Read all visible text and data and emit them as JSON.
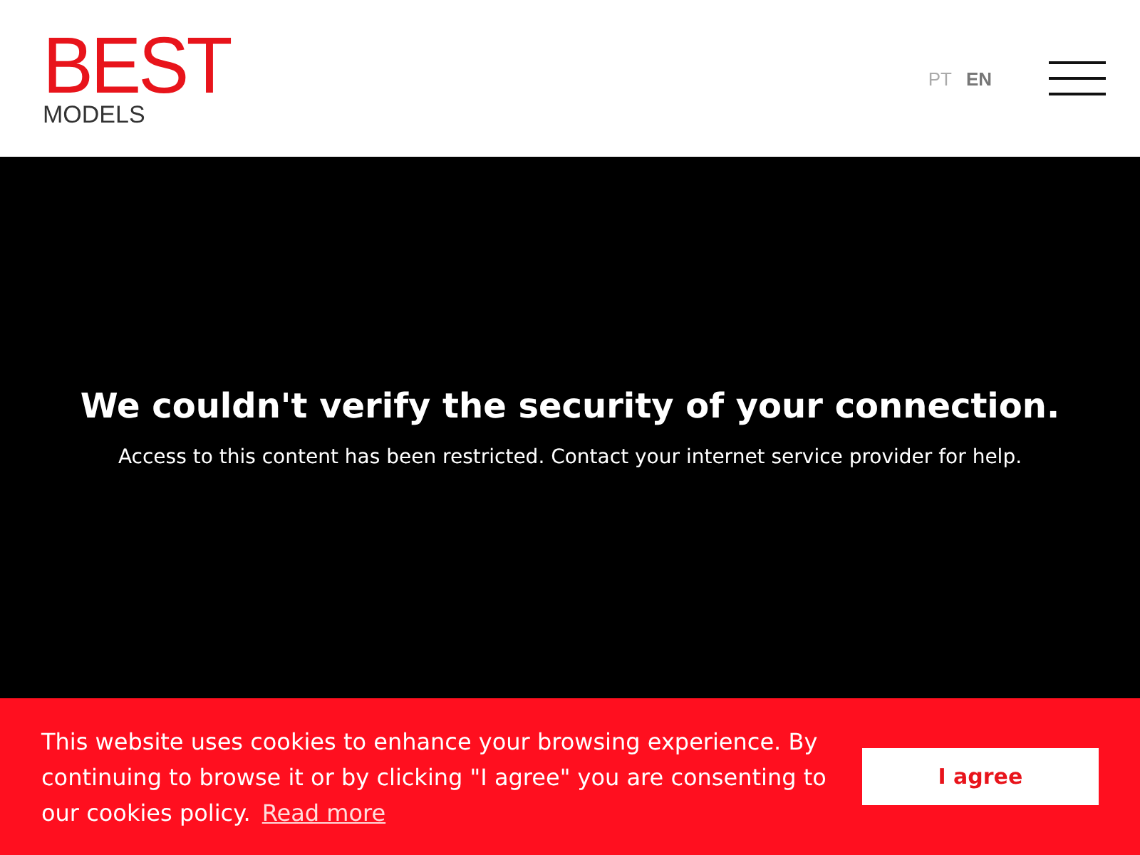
{
  "header": {
    "logo": {
      "brand": "BEST",
      "tagline": "MODELS"
    },
    "languages": [
      {
        "label": "PT",
        "selected": false
      },
      {
        "label": "EN",
        "selected": true
      }
    ]
  },
  "message": {
    "title": "We couldn't verify the security of your connection.",
    "body": "Access to this content has been restricted. Contact your internet service provider for help."
  },
  "cookie_banner": {
    "text": "This website uses cookies to enhance your browsing experience. By continuing to browse it or by clicking \"I agree\" you are consenting to our cookies policy.",
    "link": "Read more",
    "button": "I agree"
  }
}
